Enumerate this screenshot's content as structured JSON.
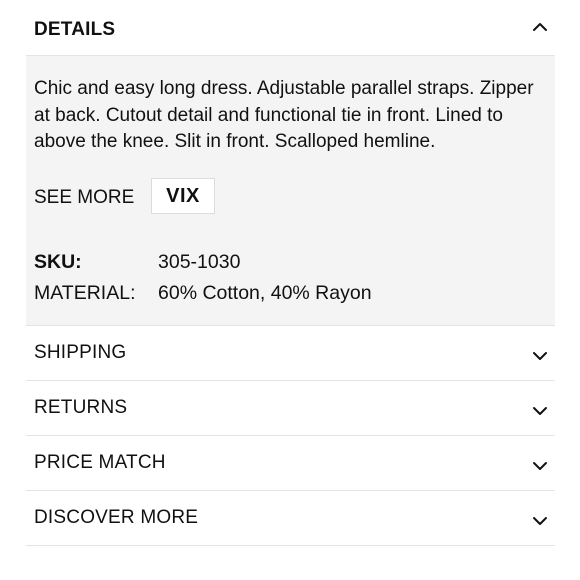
{
  "details": {
    "title": "DETAILS",
    "expanded": true,
    "description": "Chic and easy long dress. Adjustable parallel straps. Zipper at back. Cutout detail and functional tie in front. Lined to above the knee. Slit in front. Scalloped hemline.",
    "see_more_label": "SEE MORE",
    "brand": "VIX",
    "specs": [
      {
        "label": "SKU:",
        "value": "305-1030"
      },
      {
        "label": "MATERIAL:",
        "value": "60% Cotton, 40% Rayon"
      }
    ]
  },
  "sections": [
    {
      "label": "SHIPPING",
      "icon": "chevron-down-icon"
    },
    {
      "label": "RETURNS",
      "icon": "chevron-down-icon"
    },
    {
      "label": "PRICE MATCH",
      "icon": "chevron-down-icon"
    },
    {
      "label": "DISCOVER MORE",
      "icon": "chevron-down-icon"
    }
  ],
  "colors": {
    "text": "#111111",
    "panel_background": "#f4f4f4",
    "divider": "#e4e4e4"
  }
}
